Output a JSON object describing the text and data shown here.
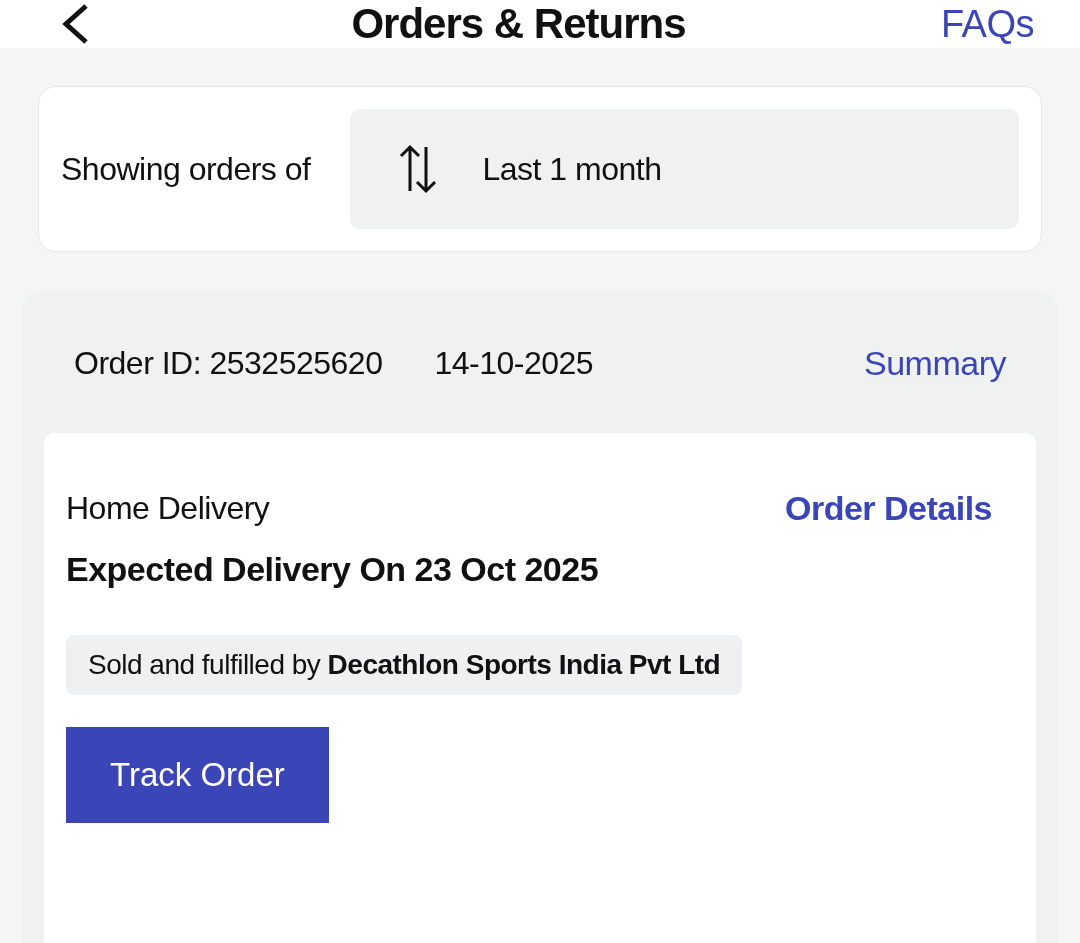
{
  "header": {
    "title": "Orders & Returns",
    "faq_link": "FAQs"
  },
  "filter": {
    "label": "Showing orders of",
    "value": "Last 1 month"
  },
  "order": {
    "id_text": "Order ID: 2532525620",
    "date": "14-10-2025",
    "summary_link": "Summary",
    "shipment": {
      "type": "Home Delivery",
      "details_link": "Order Details",
      "expected": "Expected Delivery On 23 Oct 2025",
      "seller": "Sold and fulfilled by **Decathlon Sports India Pvt Ltd**",
      "track_button": "Track Order"
    }
  }
}
